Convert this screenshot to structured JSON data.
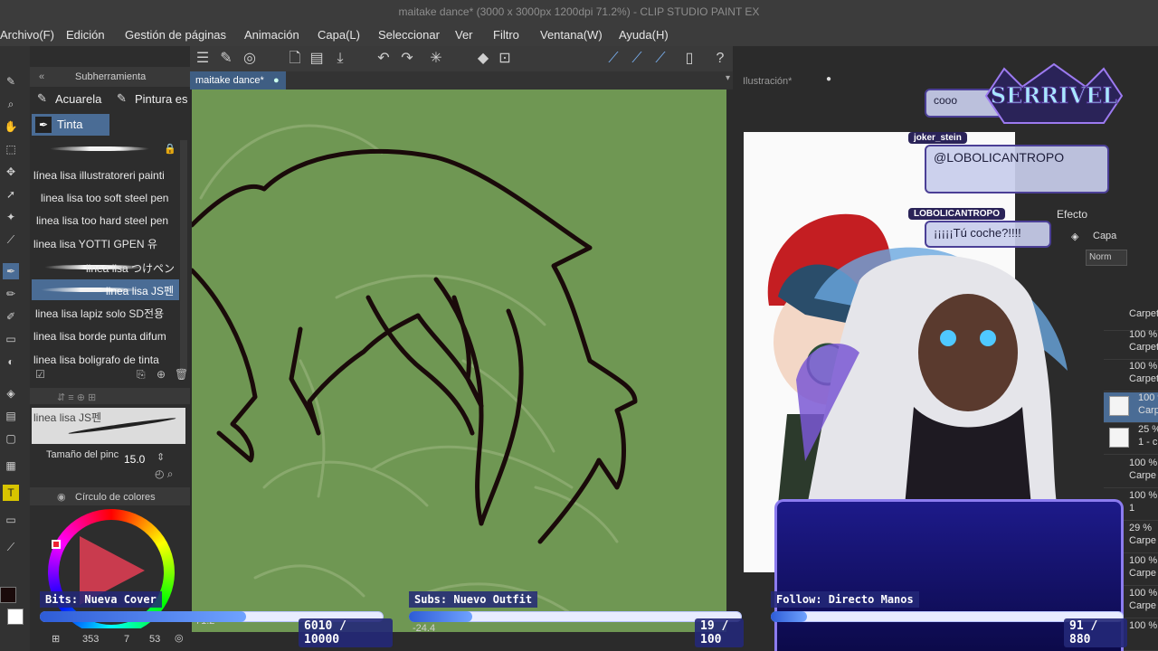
{
  "window": {
    "title": "maitake dance* (3000 x 3000px 1200dpi 71.2%) - CLIP STUDIO PAINT EX"
  },
  "menu": [
    "Archivo(F)",
    "Edición",
    "Gestión de páginas",
    "Animación",
    "Capa(L)",
    "Seleccionar",
    "Ver",
    "Filtro",
    "Ventana(W)",
    "Ayuda(H)"
  ],
  "subtool": {
    "header": "Subherramienta",
    "tabs": [
      "Acuarela",
      "Pintura es"
    ],
    "group": "Tinta",
    "brushes": [
      "línea lisa illustratoreri painti",
      "linea lisa too soft steel pen",
      "linea lisa too hard steel pen",
      "linea lisa YOTTI GPEN 유",
      "linea lisa つけペン",
      "linea lisa JS펜",
      "linea lisa lapiz solo SD전용",
      "linea lisa borde punta difum",
      "linea lisa boligrafo de tinta"
    ],
    "selected_index": 5
  },
  "tool_property": {
    "brush_name": "linea lisa JS펜",
    "size_label": "Tamaño del pinc",
    "size_value": "15.0"
  },
  "color_panel": {
    "header": "Círculo de colores"
  },
  "canvas": {
    "tab": "maitake dance*",
    "zoom": "71.2",
    "stroke_width": "-24.4"
  },
  "status": {
    "coord_x": "353",
    "coord_y": "7",
    "coord_z": "53"
  },
  "navigator": {
    "tab": "Ilustración*"
  },
  "chat": [
    {
      "user": "joker_stein",
      "message": "@LOBOLICANTROPO"
    },
    {
      "user": "LOBOLICANTROPO",
      "message": "¡¡¡¡¡Tú coche?!!!!"
    }
  ],
  "chat_top_partial": "cooo",
  "overlay": {
    "logo": "SERRIVEL"
  },
  "goals": [
    {
      "label": "Bits: Nueva Cover",
      "count": "6010 / 10000",
      "progress": 0.601
    },
    {
      "label": "Subs: Nuevo Outfit",
      "count": "19 / 100",
      "progress": 0.19
    },
    {
      "label": "Follow: Directo Manos",
      "count": "91 / 880",
      "progress": 0.103
    }
  ],
  "layer_panel": {
    "effect_label": "Efecto",
    "layer_tab": "Capa",
    "blend_mode": "Norm",
    "rows": [
      {
        "opacity": "",
        "name": "Carpeta"
      },
      {
        "opacity": "100 %",
        "name": "Carpeta"
      },
      {
        "opacity": "100 %",
        "name": "Carpeta"
      },
      {
        "opacity": "100 %",
        "name": "Carpe"
      },
      {
        "opacity": "25 %",
        "name": "1 - c"
      },
      {
        "opacity": "100 %",
        "name": "Carpe"
      },
      {
        "opacity": "100 %",
        "name": "1"
      },
      {
        "opacity": "29 %",
        "name": "Carpe"
      },
      {
        "opacity": "100 %",
        "name": "Carpe"
      },
      {
        "opacity": "100 %",
        "name": "Carpe"
      },
      {
        "opacity": "100 %",
        "name": ""
      }
    ]
  },
  "colors": {
    "accent": "#4a6c95",
    "canvas_bg": "#6f9753",
    "ink": "#1a0a0a",
    "goal_bar": "#2e5cd6"
  }
}
